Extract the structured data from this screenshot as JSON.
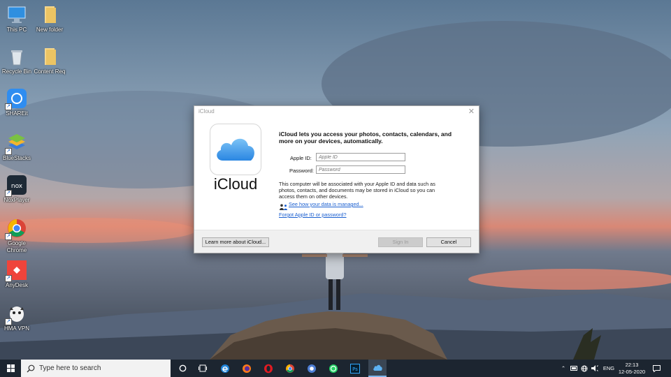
{
  "desktop": {
    "icons": [
      {
        "label": "This PC"
      },
      {
        "label": "New folder"
      },
      {
        "label": "Recycle Bin"
      },
      {
        "label": "Content Req"
      },
      {
        "label": "SHAREit"
      },
      {
        "label": "BlueStacks"
      },
      {
        "label": "NoxPlayer"
      },
      {
        "label": "Google Chrome"
      },
      {
        "label": "AnyDesk"
      },
      {
        "label": "HMA VPN"
      }
    ]
  },
  "dialog": {
    "title": "iCloud",
    "brand": "iCloud",
    "intro": "iCloud lets you access your photos, contacts, calendars, and more on your devices, automatically.",
    "apple_id_label": "Apple ID:",
    "apple_id_placeholder": "Apple ID",
    "apple_id_value": "",
    "password_label": "Password:",
    "password_placeholder": "Password",
    "password_value": "",
    "info": "This computer will be associated with your Apple ID and data such as photos, contacts, and documents may be stored in iCloud so you can access them on other devices.",
    "data_link": "See how your data is managed...",
    "forgot_link": "Forgot Apple ID or password?",
    "learn_more": "Learn more about iCloud...",
    "sign_in": "Sign In",
    "cancel": "Cancel"
  },
  "taskbar": {
    "search_placeholder": "Type here to search",
    "language": "ENG",
    "time": "22:13",
    "date": "12-05-2020"
  },
  "colors": {
    "taskbar": "#1c2530",
    "link": "#1a5fd0",
    "icloud_blue": "#3d9be9"
  }
}
